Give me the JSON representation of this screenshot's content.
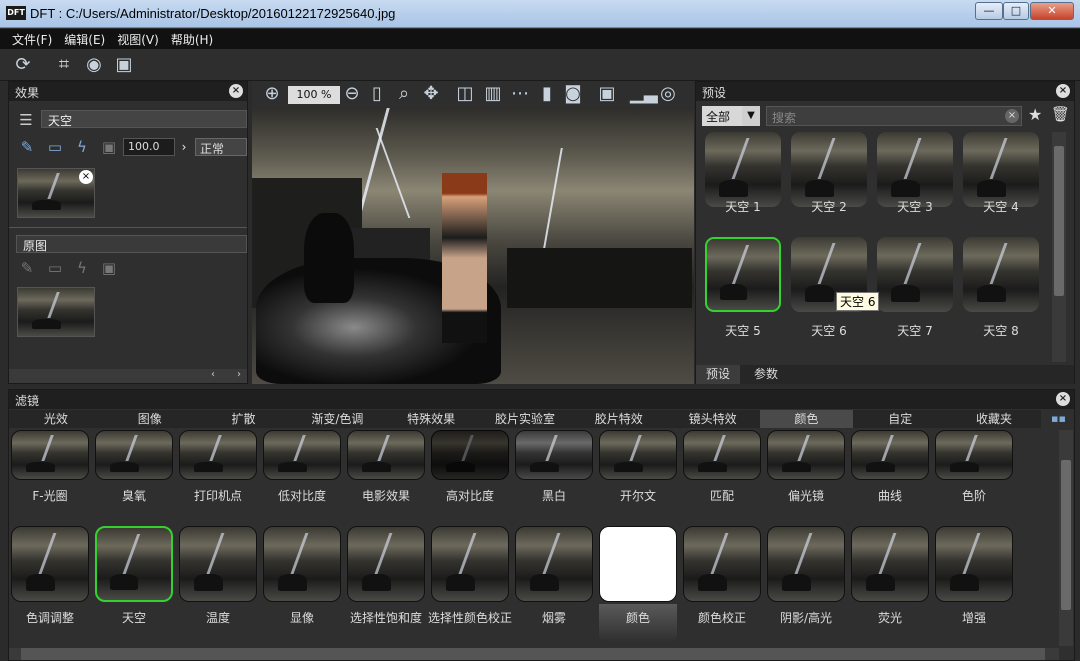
{
  "window": {
    "logo": "DFT",
    "title": "DFT : C:/Users/Administrator/Desktop/20160122172925640.jpg",
    "btn_min": "—",
    "btn_max": "□",
    "btn_close": "✕"
  },
  "menu": [
    "文件(F)",
    "编辑(E)",
    "视图(V)",
    "帮助(H)"
  ],
  "effects_panel": {
    "title": "效果",
    "layer_name": "天空",
    "opacity": "100.0",
    "blend_mode": "正常",
    "original_label": "原图"
  },
  "viewer": {
    "zoom": "100 %"
  },
  "presets_panel": {
    "title": "预设",
    "category": "全部",
    "search_placeholder": "搜索",
    "items": [
      "天空 1",
      "天空 2",
      "天空 3",
      "天空 4",
      "天空 5",
      "天空 6",
      "天空 7",
      "天空 8"
    ],
    "tooltip": "天空 6",
    "tabs": [
      "预设",
      "参数"
    ]
  },
  "filters_panel": {
    "title": "滤镜",
    "tabs": [
      "光效",
      "图像",
      "扩散",
      "渐变/色调",
      "特殊效果",
      "胶片实验室",
      "胶片特效",
      "镜头特效",
      "颜色",
      "自定",
      "收藏夹"
    ],
    "row1": [
      "F-光圈",
      "臭氧",
      "打印机点",
      "低对比度",
      "电影效果",
      "高对比度",
      "黑白",
      "开尔文",
      "匹配",
      "偏光镜",
      "曲线",
      "色阶"
    ],
    "row2": [
      "色调调整",
      "天空",
      "温度",
      "显像",
      "选择性饱和度",
      "选择性颜色校正",
      "烟雾",
      "颜色",
      "颜色校正",
      "阴影/高光",
      "荧光",
      "增强"
    ]
  },
  "colors": {
    "accent_green": "#35d12e",
    "panel_bg": "#2f2f2f"
  }
}
